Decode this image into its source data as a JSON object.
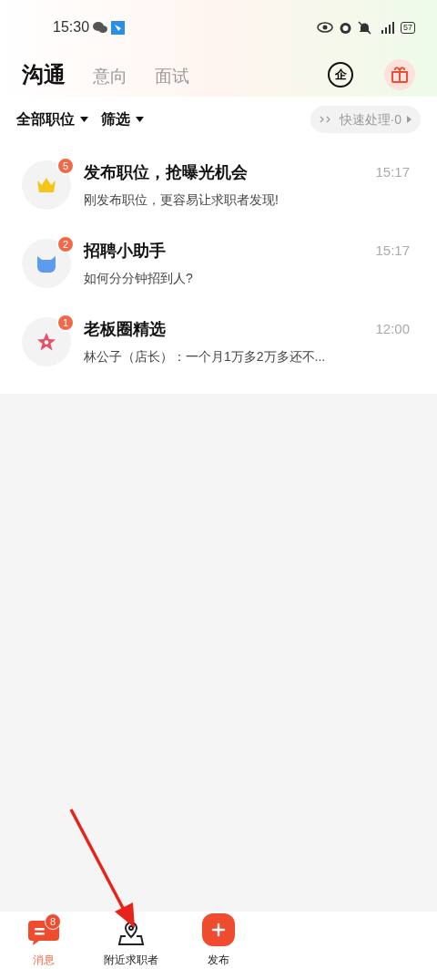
{
  "status_bar": {
    "time": "15:30",
    "battery": "57"
  },
  "tabs": [
    {
      "label": "沟通",
      "selected": true
    },
    {
      "label": "意向",
      "selected": false
    },
    {
      "label": "面试",
      "selected": false
    }
  ],
  "enterprise_badge": "企",
  "filters": [
    {
      "label": "全部职位"
    },
    {
      "label": "筛选"
    }
  ],
  "quick_action": {
    "label": "快速处理·0",
    "disabled": true
  },
  "messages": [
    {
      "kind": "crown",
      "title": "发布职位，抢曝光机会",
      "preview": "刚发布职位，更容易让求职者发现!",
      "time": "15:17",
      "count": "5"
    },
    {
      "kind": "cat",
      "title": "招聘小助手",
      "preview": "如何分分钟招到人?",
      "time": "15:17",
      "count": "2"
    },
    {
      "kind": "star",
      "title": "老板圈精选",
      "preview": "林公子（店长）：一个月1万多2万多还不...",
      "time": "12:00",
      "count": "1"
    }
  ],
  "nav": [
    {
      "kind": "chat",
      "label": "消息",
      "selected": true,
      "count": "8"
    },
    {
      "kind": "pin",
      "label": "附近求职者",
      "selected": false
    },
    {
      "kind": "plus",
      "label": "发布",
      "selected": false
    }
  ]
}
